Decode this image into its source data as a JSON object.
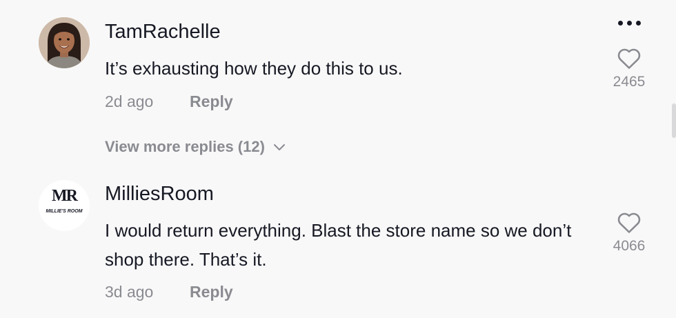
{
  "comments": [
    {
      "username": "TamRachelle",
      "text": "It’s exhausting how they do this to us.",
      "time": "2d ago",
      "reply_label": "Reply",
      "likes": "2465",
      "view_more_label": "View more replies (12)"
    },
    {
      "username": "MilliesRoom",
      "text": "I would return everything. Blast the store name so we don’t shop there. That’s it.",
      "time": "3d ago",
      "reply_label": "Reply",
      "likes": "4066",
      "avatar_logo_text": "MR",
      "avatar_logo_subtext": "MILLIE'S ROOM"
    }
  ],
  "colors": {
    "background": "#f8f8f8",
    "primary_text": "#161823",
    "secondary_text": "#8a8b91"
  },
  "icons": [
    "more-options-icon",
    "heart-outline-icon",
    "chevron-down-icon"
  ]
}
